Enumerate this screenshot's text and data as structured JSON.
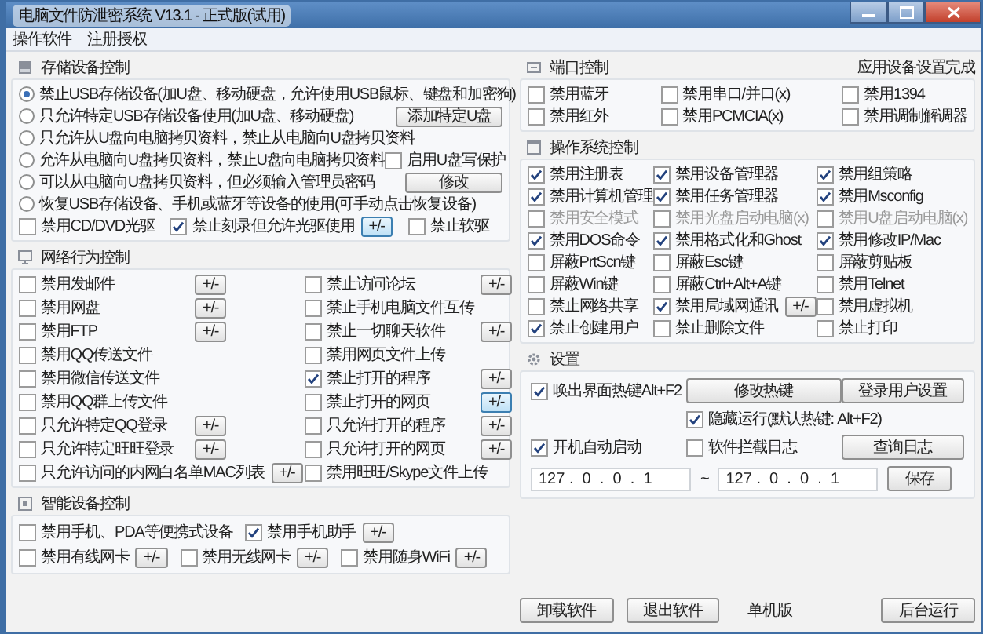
{
  "window": {
    "title": "电脑文件防泄密系统 V13.1 - 正式版(试用)"
  },
  "menu": [
    {
      "label": "操作软件"
    },
    {
      "label": "注册授权"
    }
  ],
  "storage": {
    "title": "存储设备控制",
    "options": [
      {
        "label": "禁止USB存储设备(加U盘、移动硬盘，允许使用USB鼠标、键盘和加密狗)",
        "selected": true
      },
      {
        "label": "只允许特定USB存储设备使用(加U盘、移动硬盘)",
        "selected": false,
        "extra": {
          "kind": "button",
          "label": "添加特定U盘"
        }
      },
      {
        "label": "只允许从U盘向电脑拷贝资料，禁止从电脑向U盘拷贝资料",
        "selected": false
      },
      {
        "label": "允许从电脑向U盘拷贝资料，禁止U盘向电脑拷贝资料",
        "selected": false,
        "extra": {
          "kind": "checkbox",
          "label": "启用U盘写保护",
          "checked": false
        }
      },
      {
        "label": "可以从电脑向U盘拷贝资料，但必须输入管理员密码",
        "selected": false,
        "extra": {
          "kind": "button",
          "label": "修改"
        }
      },
      {
        "label": "恢复USB存储设备、手机或蓝牙等设备的使用(可手动点击恢复设备)",
        "selected": false
      }
    ],
    "checks": [
      {
        "label": "禁用CD/DVD光驱",
        "checked": false
      },
      {
        "label": "禁止刻录但允许光驱使用",
        "checked": true,
        "button": {
          "label": "+/-",
          "focused": true
        }
      },
      {
        "label": "禁止软驱",
        "checked": false
      }
    ]
  },
  "network": {
    "title": "网络行为控制",
    "items": [
      {
        "label": "禁用发邮件",
        "checked": false,
        "button": {
          "label": "+/-",
          "focused": false
        }
      },
      {
        "label": "禁止访问论坛",
        "checked": false,
        "button": {
          "label": "+/-",
          "focused": false
        }
      },
      {
        "label": "禁用网盘",
        "checked": false,
        "button": {
          "label": "+/-",
          "focused": false
        }
      },
      {
        "label": "禁止手机电脑文件互传",
        "checked": false
      },
      {
        "label": "禁用FTP",
        "checked": false,
        "button": {
          "label": "+/-",
          "focused": false
        }
      },
      {
        "label": "禁止一切聊天软件",
        "checked": false,
        "button": {
          "label": "+/-",
          "focused": false
        }
      },
      {
        "label": "禁用QQ传送文件",
        "checked": false
      },
      {
        "label": "禁用网页文件上传",
        "checked": false
      },
      {
        "label": "禁用微信传送文件",
        "checked": false
      },
      {
        "label": "禁止打开的程序",
        "checked": true,
        "button": {
          "label": "+/-",
          "focused": false
        }
      },
      {
        "label": "禁用QQ群上传文件",
        "checked": false
      },
      {
        "label": "禁止打开的网页",
        "checked": false,
        "button": {
          "label": "+/-",
          "focused": true
        }
      },
      {
        "label": "只允许特定QQ登录",
        "checked": false,
        "button": {
          "label": "+/-",
          "focused": false
        }
      },
      {
        "label": "只允许打开的程序",
        "checked": false,
        "button": {
          "label": "+/-",
          "focused": false
        }
      },
      {
        "label": "只允许特定旺旺登录",
        "checked": false,
        "button": {
          "label": "+/-",
          "focused": false
        }
      },
      {
        "label": "只允许打开的网页",
        "checked": false,
        "button": {
          "label": "+/-",
          "focused": false
        }
      },
      {
        "label": "只允许访问的内网白名单MAC列表",
        "checked": false,
        "button": {
          "label": "+/-",
          "focused": false
        }
      },
      {
        "label": "禁用旺旺/Skype文件上传",
        "checked": false
      }
    ]
  },
  "smart": {
    "title": "智能设备控制",
    "rows": [
      [
        {
          "label": "禁用手机、PDA等便携式设备",
          "checked": false
        },
        {
          "label": "禁用手机助手",
          "checked": true,
          "button": {
            "label": "+/-",
            "focused": false
          }
        }
      ],
      [
        {
          "label": "禁用有线网卡",
          "checked": false,
          "button": {
            "label": "+/-",
            "focused": false
          }
        },
        {
          "label": "禁用无线网卡",
          "checked": false,
          "button": {
            "label": "+/-",
            "focused": false
          }
        },
        {
          "label": "禁用随身WiFi",
          "checked": false,
          "button": {
            "label": "+/-",
            "focused": false
          }
        }
      ]
    ]
  },
  "ports": {
    "title": "端口控制",
    "status": "应用设备设置完成",
    "items": [
      {
        "label": "禁用蓝牙",
        "checked": false
      },
      {
        "label": "禁用串口/并口(x)",
        "checked": false
      },
      {
        "label": "禁用1394",
        "checked": false
      },
      {
        "label": "禁用红外",
        "checked": false
      },
      {
        "label": "禁用PCMCIA(x)",
        "checked": false
      },
      {
        "label": "禁用调制解调器",
        "checked": false
      }
    ]
  },
  "os": {
    "title": "操作系统控制",
    "items": [
      {
        "label": "禁用注册表",
        "checked": true,
        "disabled": false
      },
      {
        "label": "禁用设备管理器",
        "checked": true,
        "disabled": false
      },
      {
        "label": "禁用组策略",
        "checked": true,
        "disabled": false
      },
      {
        "label": "禁用计算机管理",
        "checked": true,
        "disabled": false
      },
      {
        "label": "禁用任务管理器",
        "checked": true,
        "disabled": false
      },
      {
        "label": "禁用Msconfig",
        "checked": true,
        "disabled": false
      },
      {
        "label": "禁用安全模式",
        "checked": false,
        "disabled": true
      },
      {
        "label": "禁用光盘启动电脑(x)",
        "checked": false,
        "disabled": true
      },
      {
        "label": "禁用U盘启动电脑(x)",
        "checked": false,
        "disabled": true
      },
      {
        "label": "禁用DOS命令",
        "checked": true,
        "disabled": false
      },
      {
        "label": "禁用格式化和Ghost",
        "checked": true,
        "disabled": false
      },
      {
        "label": "禁用修改IP/Mac",
        "checked": true,
        "disabled": false
      },
      {
        "label": "屏蔽PrtScn键",
        "checked": false,
        "disabled": false
      },
      {
        "label": "屏蔽Esc键",
        "checked": false,
        "disabled": false
      },
      {
        "label": "屏蔽剪贴板",
        "checked": false,
        "disabled": false
      },
      {
        "label": "屏蔽Win键",
        "checked": false,
        "disabled": false
      },
      {
        "label": "屏蔽Ctrl+Alt+A键",
        "checked": false,
        "disabled": false
      },
      {
        "label": "禁用Telnet",
        "checked": false,
        "disabled": false
      },
      {
        "label": "禁止网络共享",
        "checked": false,
        "disabled": false
      },
      {
        "label": "禁用局域网通讯",
        "checked": true,
        "disabled": false,
        "button": {
          "label": "+/-",
          "focused": false
        }
      },
      {
        "label": "禁用虚拟机",
        "checked": false,
        "disabled": false
      },
      {
        "label": "禁止创建用户",
        "checked": true,
        "disabled": false
      },
      {
        "label": "禁止删除文件",
        "checked": false,
        "disabled": false
      },
      {
        "label": "禁止打印",
        "checked": false,
        "disabled": false
      }
    ]
  },
  "settings": {
    "title": "设置",
    "hotkey": {
      "label": "唤出界面热键Alt+F2",
      "checked": true
    },
    "change_hotkey_button": "修改热键",
    "login_settings_button": "登录用户设置",
    "hidden_run": {
      "label": "隐藏运行(默认热键: Alt+F2)",
      "checked": true
    },
    "autostart": {
      "label": "开机自动启动",
      "checked": true
    },
    "intercept_log": {
      "label": "软件拦截日志",
      "checked": false
    },
    "log_button": "查询日志",
    "ip_from": "127 .  0  .  0  .  1",
    "ip_separator": "~",
    "ip_to": "127 .  0  .  0  .  1",
    "save_button": "保存"
  },
  "footer": {
    "left_buttons": [
      "卸载软件",
      "退出软件"
    ],
    "edition": "单机版",
    "right_button": "后台运行"
  }
}
